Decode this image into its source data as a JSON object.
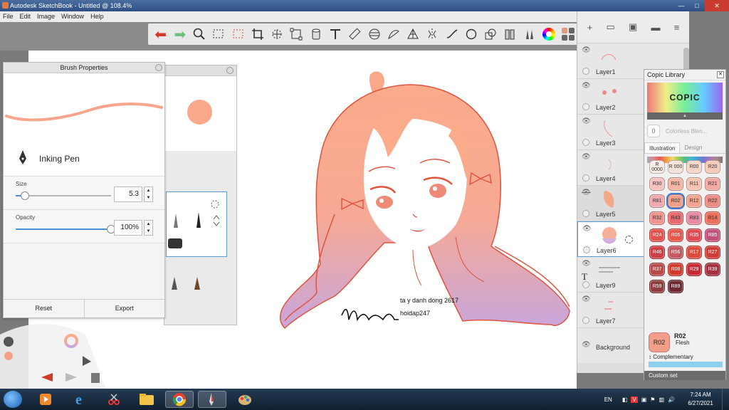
{
  "window": {
    "title": "Autodesk SketchBook - Untitled @ 108.4%"
  },
  "menu": [
    "File",
    "Edit",
    "Image",
    "Window",
    "Help"
  ],
  "brush_panel": {
    "title": "Brush Properties",
    "brush_name": "Inking Pen",
    "size": {
      "label": "Size",
      "value": "5.3",
      "fraction": 0.1
    },
    "opacity": {
      "label": "Opacity",
      "value": "100%",
      "fraction": 1.0
    },
    "reset_label": "Reset",
    "export_label": "Export"
  },
  "layers": [
    {
      "name": "Layer1",
      "visible": true
    },
    {
      "name": "Layer2",
      "visible": true
    },
    {
      "name": "Layer3",
      "visible": true
    },
    {
      "name": "Layer4",
      "visible": true
    },
    {
      "name": "Layer5",
      "visible": false
    },
    {
      "name": "Layer6",
      "visible": true,
      "active": true
    },
    {
      "name": "Layer9",
      "visible": true
    },
    {
      "name": "Layer7",
      "visible": true
    },
    {
      "name": "Background",
      "visible": true
    }
  ],
  "canvas": {
    "caption_line1": "ta y danh dong 2617",
    "caption_line2": "hoidap247"
  },
  "copic": {
    "title": "Copic Library",
    "logo": "COPIC",
    "colorless": "Colorless Blen...",
    "colorless_code": "0",
    "tab_illustration": "Illustration",
    "tab_design": "Design",
    "swatches": [
      {
        "code": "R 0000",
        "color": "#f7ece6"
      },
      {
        "code": "R 000",
        "color": "#f6e2d8"
      },
      {
        "code": "R00",
        "color": "#f7d6c8"
      },
      {
        "code": "R20",
        "color": "#f8c8b8"
      },
      {
        "code": "R30",
        "color": "#f5c2bd"
      },
      {
        "code": "R01",
        "color": "#f4b5a5"
      },
      {
        "code": "R11",
        "color": "#f4c4b3"
      },
      {
        "code": "R21",
        "color": "#f2a8a0"
      },
      {
        "code": "R81",
        "color": "#f0aab0"
      },
      {
        "code": "R02",
        "color": "#f19f88",
        "selected": true
      },
      {
        "code": "R12",
        "color": "#f2a58e"
      },
      {
        "code": "R22",
        "color": "#ee8a84"
      },
      {
        "code": "R32",
        "color": "#ee9590"
      },
      {
        "code": "R43",
        "color": "#e8696e"
      },
      {
        "code": "R83",
        "color": "#e88aa0"
      },
      {
        "code": "R14",
        "color": "#ed6f5e"
      },
      {
        "code": "R24",
        "color": "#e3524c"
      },
      {
        "code": "R05",
        "color": "#e9564a"
      },
      {
        "code": "R35",
        "color": "#e24a52"
      },
      {
        "code": "R85",
        "color": "#c2507a"
      },
      {
        "code": "R46",
        "color": "#cf3d45"
      },
      {
        "code": "R56",
        "color": "#c25a60"
      },
      {
        "code": "R17",
        "color": "#dd4a3d"
      },
      {
        "code": "R27",
        "color": "#d03b36"
      },
      {
        "code": "R37",
        "color": "#b94a4a"
      },
      {
        "code": "R08",
        "color": "#d43a2b"
      },
      {
        "code": "R29",
        "color": "#c72a34"
      },
      {
        "code": "R39",
        "color": "#a63040"
      },
      {
        "code": "R59",
        "color": "#8e3e40"
      },
      {
        "code": "R89",
        "color": "#6d2a34"
      }
    ],
    "current_code": "R02",
    "current_name": "Flesh",
    "current_chip": "R02",
    "complementary": "Complementary",
    "custom_set": "Custom set"
  },
  "taskbar": {
    "lang": "EN",
    "time": "7:24 AM",
    "date": "6/27/2021"
  },
  "colors": {
    "hair": "#f9a88a",
    "lilac": "#c9a8d8",
    "line": "#e0533d"
  }
}
